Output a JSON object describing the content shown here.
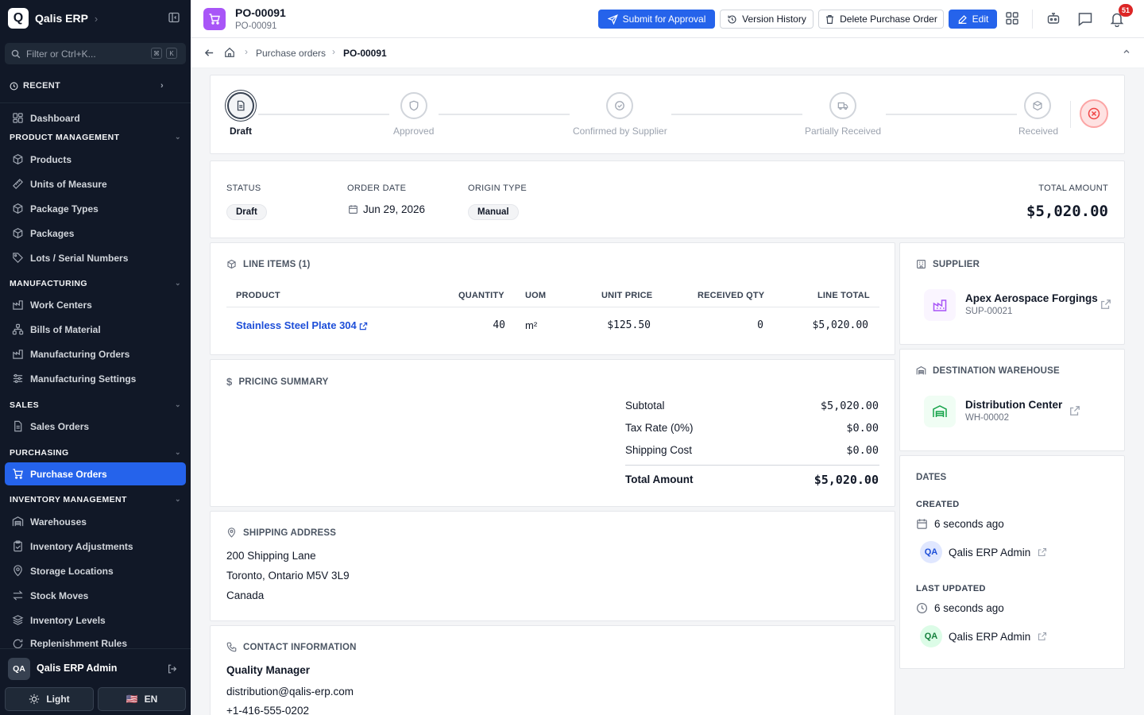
{
  "sidebar": {
    "brand_logo": "Q",
    "brand_name": "Qalis ERP",
    "filter_placeholder": "Filter or Ctrl+K...",
    "kbd1": "⌘",
    "kbd2": "K",
    "recent": "RECENT",
    "dashboard": "Dashboard",
    "sections": {
      "product": "PRODUCT MANAGEMENT",
      "manufacturing": "MANUFACTURING",
      "sales": "SALES",
      "purchasing": "PURCHASING",
      "inventory": "INVENTORY MANAGEMENT"
    },
    "items": {
      "products": "Products",
      "uom": "Units of Measure",
      "package_types": "Package Types",
      "packages": "Packages",
      "lots": "Lots / Serial Numbers",
      "work_centers": "Work Centers",
      "bom": "Bills of Material",
      "mfg_orders": "Manufacturing Orders",
      "mfg_settings": "Manufacturing Settings",
      "sales_orders": "Sales Orders",
      "purchase_orders": "Purchase Orders",
      "warehouses": "Warehouses",
      "inv_adjust": "Inventory Adjustments",
      "storage_loc": "Storage Locations",
      "stock_moves": "Stock Moves",
      "inv_levels": "Inventory Levels",
      "replenish": "Replenishment Rules"
    },
    "user_initials": "QA",
    "user_name": "Qalis ERP Admin",
    "theme_label": "Light",
    "lang_label": "EN",
    "flag": "🇺🇸"
  },
  "header": {
    "title": "PO-00091",
    "subtitle": "PO-00091",
    "submit": "Submit for Approval",
    "history": "Version History",
    "delete": "Delete Purchase Order",
    "edit": "Edit",
    "notif_count": "51"
  },
  "breadcrumb": {
    "parent": "Purchase orders",
    "current": "PO-00091"
  },
  "steps": [
    {
      "label": "Draft"
    },
    {
      "label": "Approved"
    },
    {
      "label": "Confirmed by Supplier"
    },
    {
      "label": "Partially Received"
    },
    {
      "label": "Received"
    }
  ],
  "summary": {
    "status_label": "STATUS",
    "status": "Draft",
    "order_date_label": "ORDER DATE",
    "order_date": "Jun 29, 2026",
    "origin_label": "ORIGIN TYPE",
    "origin": "Manual",
    "total_label": "TOTAL AMOUNT",
    "total": "$5,020.00"
  },
  "line_items": {
    "title": "LINE ITEMS (1)",
    "columns": {
      "product": "PRODUCT",
      "quantity": "QUANTITY",
      "uom": "UOM",
      "unit_price": "UNIT PRICE",
      "received": "RECEIVED QTY",
      "line_total": "LINE TOTAL"
    },
    "rows": [
      {
        "product": "Stainless Steel Plate 304",
        "quantity": "40",
        "uom": "m²",
        "unit_price": "$125.50",
        "received": "0",
        "line_total": "$5,020.00"
      }
    ]
  },
  "pricing": {
    "title": "PRICING SUMMARY",
    "subtotal_label": "Subtotal",
    "subtotal": "$5,020.00",
    "tax_label": "Tax Rate (0%)",
    "tax": "$0.00",
    "shipping_label": "Shipping Cost",
    "shipping": "$0.00",
    "total_label": "Total Amount",
    "total": "$5,020.00"
  },
  "shipping": {
    "title": "SHIPPING ADDRESS",
    "line1": "200 Shipping Lane",
    "line2": "Toronto, Ontario M5V 3L9",
    "line3": "Canada"
  },
  "contact": {
    "title": "CONTACT INFORMATION",
    "name": "Quality Manager",
    "email": "distribution@qalis-erp.com",
    "phone": "+1-416-555-0202"
  },
  "supplier": {
    "title": "SUPPLIER",
    "name": "Apex Aerospace Forgings",
    "code": "SUP-00021"
  },
  "warehouse": {
    "title": "DESTINATION WAREHOUSE",
    "name": "Distribution Center",
    "code": "WH-00002"
  },
  "dates": {
    "title": "DATES",
    "created_label": "CREATED",
    "created": "6 seconds ago",
    "created_by": "Qalis ERP Admin",
    "created_initials": "QA",
    "updated_label": "LAST UPDATED",
    "updated": "6 seconds ago",
    "updated_by": "Qalis ERP Admin",
    "updated_initials": "QA"
  },
  "colors": {
    "accent": "#2563eb",
    "sidebar": "#111827",
    "doc_icon": "#a855f7",
    "cancel": "#ef4444"
  }
}
